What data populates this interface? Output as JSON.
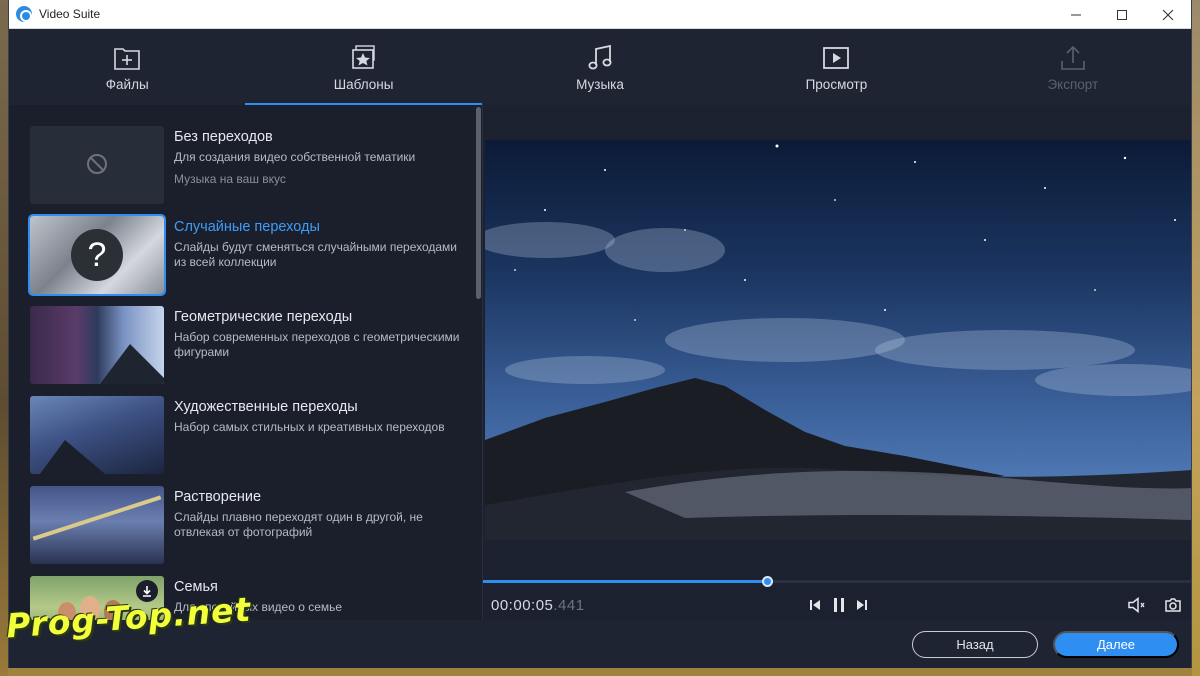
{
  "window": {
    "title": "Video Suite",
    "controls": [
      "minimize-icon",
      "maximize-icon",
      "close-icon"
    ]
  },
  "nav": {
    "tabs": [
      {
        "label": "Файлы",
        "icon": "add-file-icon",
        "state": "normal"
      },
      {
        "label": "Шаблоны",
        "icon": "templates-star-icon",
        "state": "active"
      },
      {
        "label": "Музыка",
        "icon": "music-note-icon",
        "state": "normal"
      },
      {
        "label": "Просмотр",
        "icon": "play-preview-icon",
        "state": "normal"
      },
      {
        "label": "Экспорт",
        "icon": "export-upload-icon",
        "state": "disabled"
      }
    ]
  },
  "templates": {
    "items": [
      {
        "title": "Без переходов",
        "desc": "Для создания видео собственной тематики",
        "extra": "Музыка на ваш вкус",
        "thumb": "no-transition-icon"
      },
      {
        "title": "Случайные переходы",
        "desc": "Слайды будут сменяться случайными переходами из всей коллекции",
        "extra": "",
        "thumb": "question-icon",
        "selected": true
      },
      {
        "title": "Геометрические переходы",
        "desc": "Набор современных переходов с геометрическими фигурами",
        "extra": ""
      },
      {
        "title": "Художественные переходы",
        "desc": "Набор самых стильных и креативных переходов",
        "extra": ""
      },
      {
        "title": "Растворение",
        "desc": "Слайды плавно переходят один в другой, не отвлекая от фотографий",
        "extra": ""
      },
      {
        "title": "Семья",
        "desc": "Для спокойных видео о семье",
        "extra": "",
        "thumb": "download-icon"
      }
    ]
  },
  "player": {
    "time_main": "00:00:05",
    "time_ms": ".441",
    "progress": 0.4,
    "controls": [
      "prev-frame-icon",
      "pause-icon",
      "next-frame-icon",
      "volume-icon",
      "snapshot-camera-icon"
    ]
  },
  "footer": {
    "back_label": "Назад",
    "next_label": "Далее"
  },
  "watermark": "Prog-Top.net",
  "colors": {
    "accent": "#2e8ef2",
    "bg": "#1c2130",
    "watermark": "#f4ff3c"
  }
}
